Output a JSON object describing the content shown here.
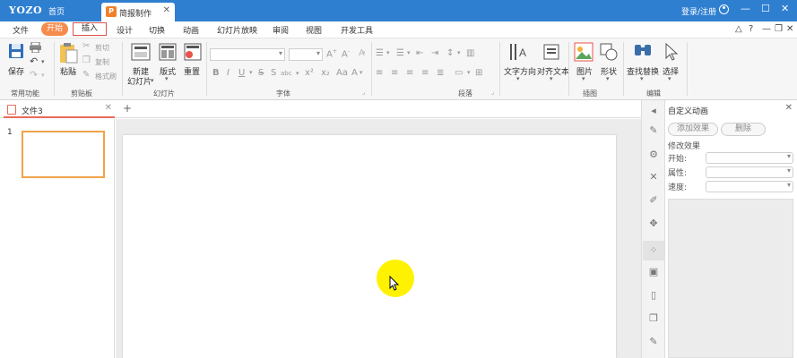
{
  "titlebar": {
    "brand": "YOZO",
    "home_tab": "首页",
    "doc_tab": "简报制作",
    "doc_logo": "P",
    "login": "登录/注册",
    "win_min": "—",
    "win_max": "☐",
    "win_close": "✕"
  },
  "menu": {
    "file": "文件",
    "start": "开始",
    "insert": "插入",
    "design": "设计",
    "switch": "切换",
    "animation": "动画",
    "slideshow": "幻灯片放映",
    "review": "审阅",
    "view": "视图",
    "devtools": "开发工具"
  },
  "ribbon": {
    "save": "保存",
    "common_group": "常用功能",
    "paste": "粘贴",
    "cut": "剪切",
    "copy": "复制",
    "format_painter": "格式刷",
    "clipboard_group": "剪贴板",
    "new_slide_line1": "新建",
    "new_slide_line2": "幻灯片",
    "layout": "版式",
    "reset": "重置",
    "slide_group": "幻灯片",
    "font_group": "字体",
    "paragraph_group": "段落",
    "text_direction": "文字方向",
    "align_text": "对齐文本",
    "picture": "图片",
    "shape": "形状",
    "illustration_group": "插图",
    "find_replace": "查找替换",
    "select": "选择",
    "edit_group": "编辑"
  },
  "tabs": {
    "file_name": "文件3",
    "close": "✕",
    "plus": "+"
  },
  "thumbs": {
    "slide_number": "1"
  },
  "panel": {
    "title": "自定义动画",
    "close": "✕",
    "add_effect": "添加效果",
    "delete": "删除",
    "modify": "修改效果",
    "start": "开始:",
    "property": "属性:",
    "speed": "速度:"
  },
  "colors": {
    "titlebar": "#2f7fd1",
    "accent_orange": "#f58b4c",
    "highlight_yellow": "#fff200"
  }
}
